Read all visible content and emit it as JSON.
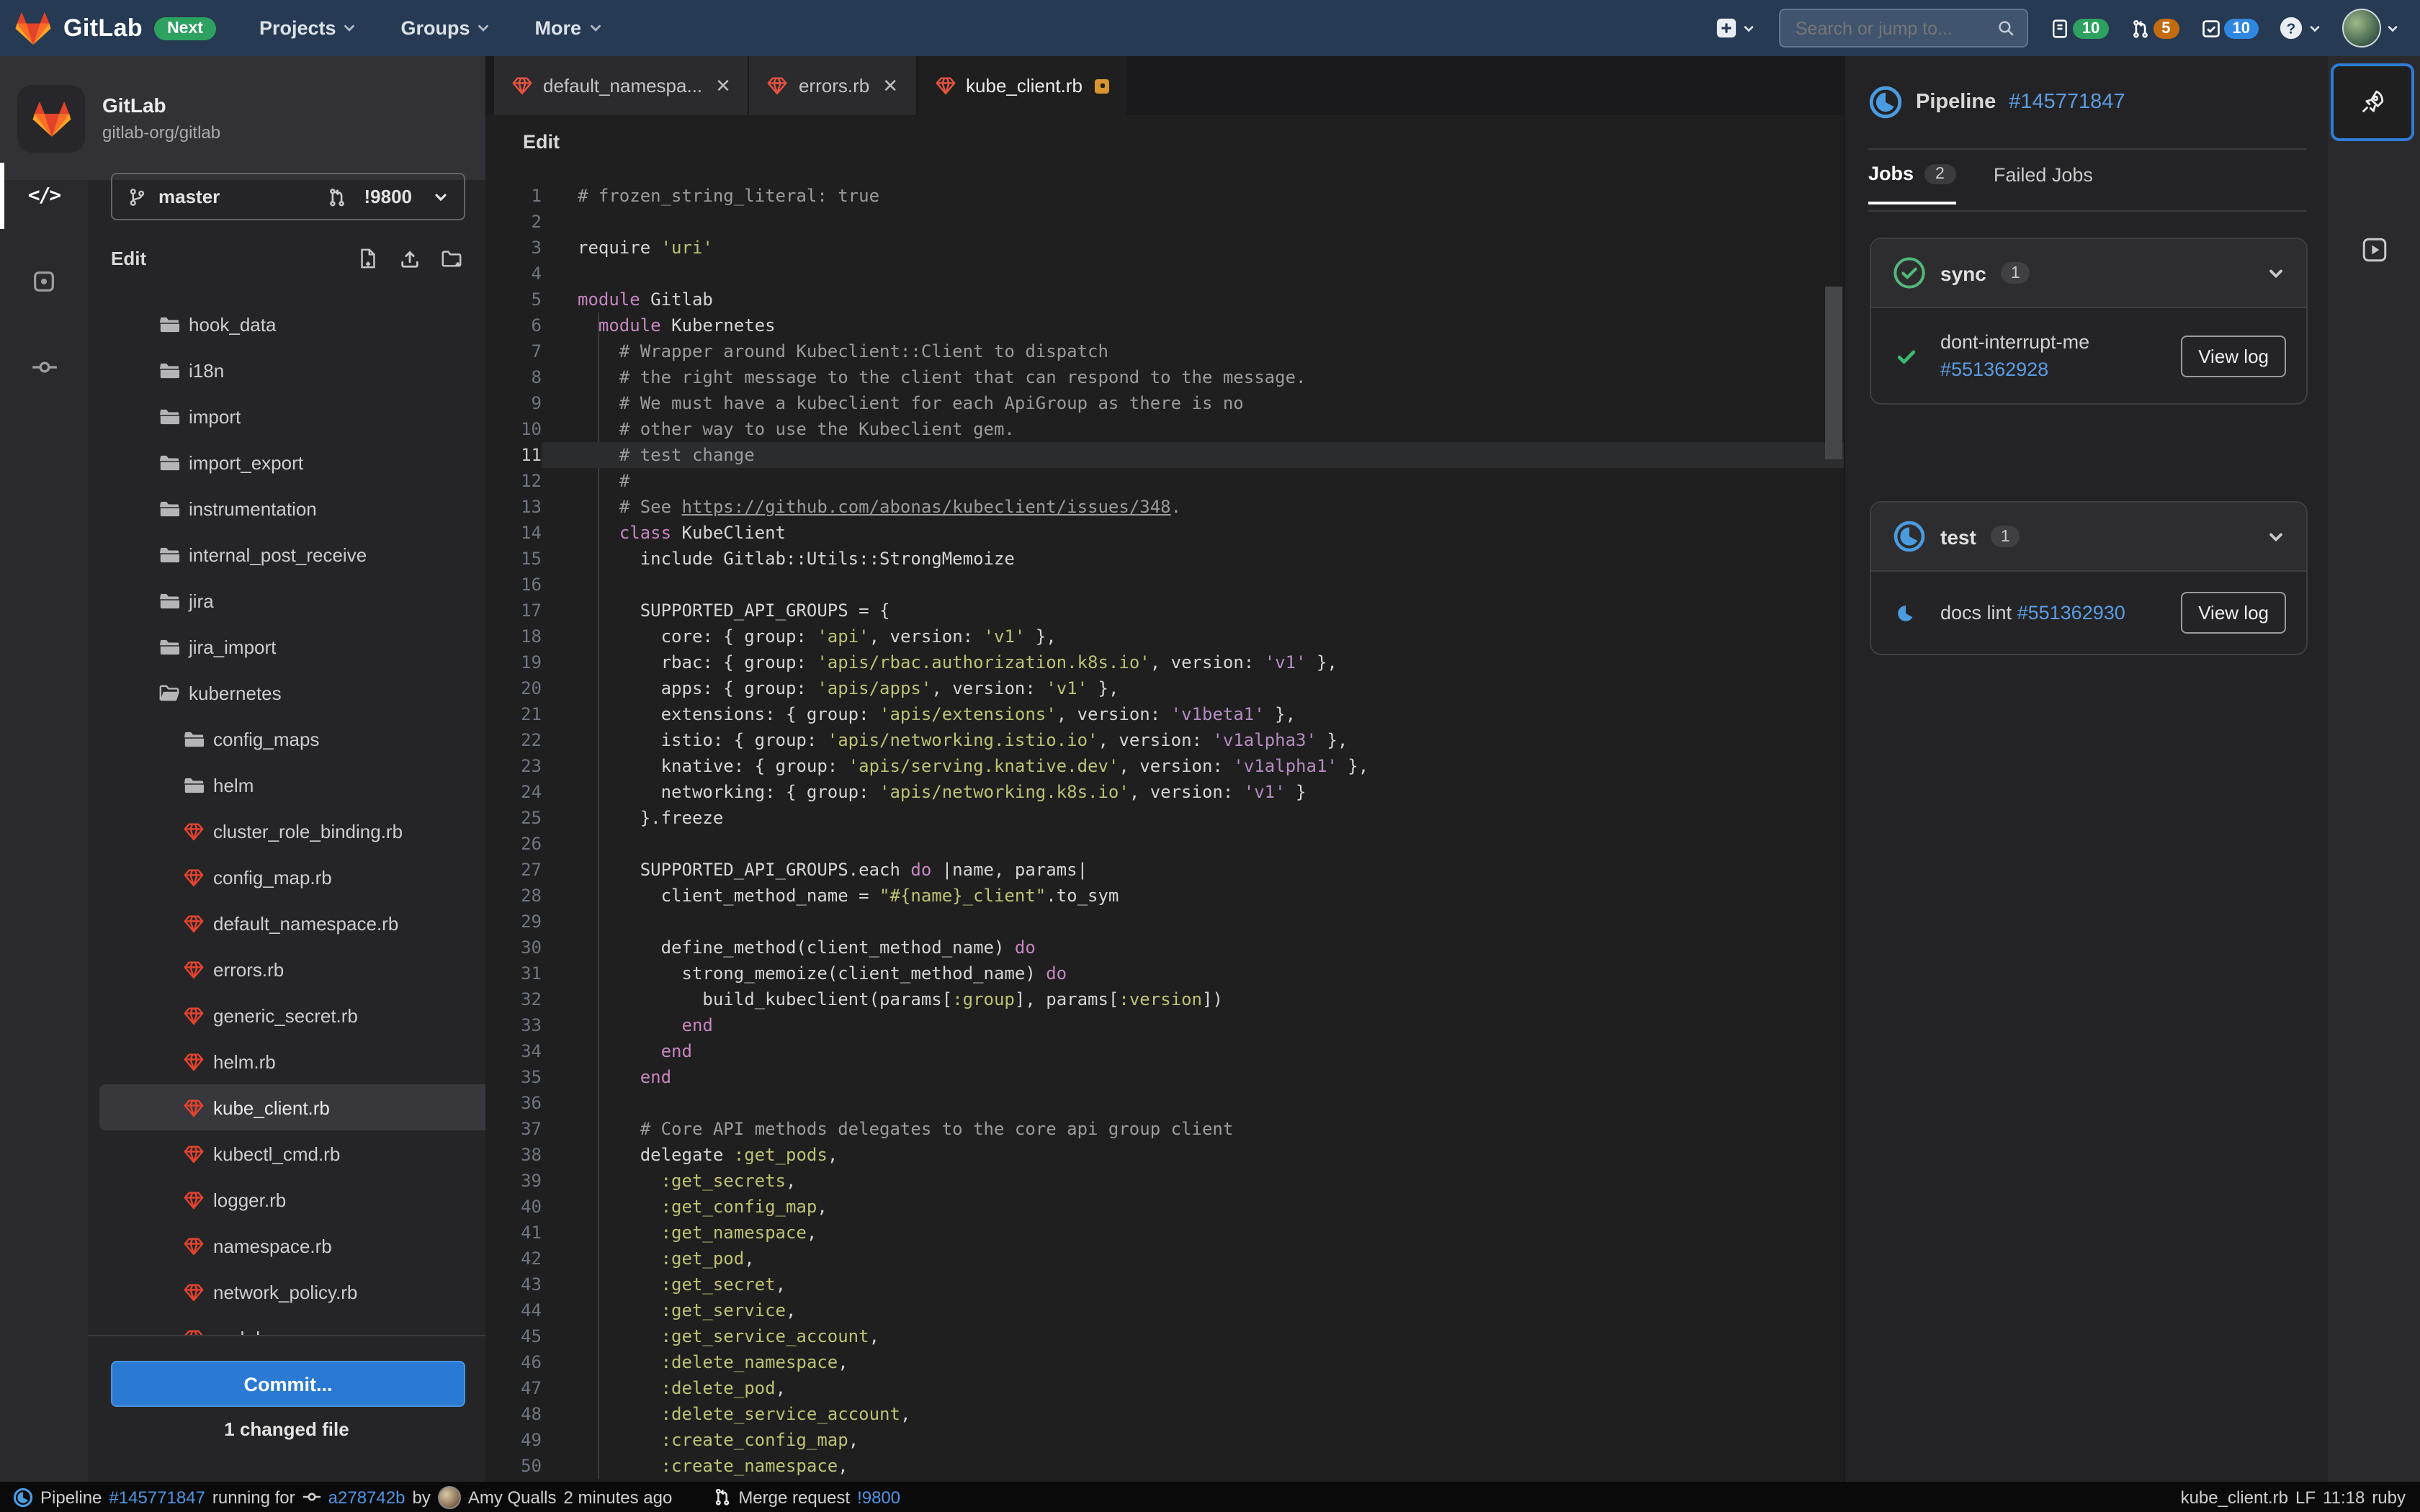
{
  "navbar": {
    "logo_label": "GitLab",
    "next_badge": "Next",
    "menus": [
      {
        "label": "Projects"
      },
      {
        "label": "Groups"
      },
      {
        "label": "More"
      }
    ],
    "search_placeholder": "Search or jump to...",
    "counters": {
      "issues": "10",
      "merge_requests": "5",
      "todos": "10"
    }
  },
  "sidebar": {
    "project": {
      "name": "GitLab",
      "path": "gitlab-org/gitlab"
    },
    "branch": {
      "name": "master",
      "merge_request": "!9800"
    },
    "section_label": "Edit",
    "tree": [
      {
        "name": "hook_data",
        "kind": "folder",
        "level": 0
      },
      {
        "name": "i18n",
        "kind": "folder",
        "level": 0
      },
      {
        "name": "import",
        "kind": "folder",
        "level": 0
      },
      {
        "name": "import_export",
        "kind": "folder",
        "level": 0
      },
      {
        "name": "instrumentation",
        "kind": "folder",
        "level": 0
      },
      {
        "name": "internal_post_receive",
        "kind": "folder",
        "level": 0
      },
      {
        "name": "jira",
        "kind": "folder",
        "level": 0
      },
      {
        "name": "jira_import",
        "kind": "folder",
        "level": 0
      },
      {
        "name": "kubernetes",
        "kind": "folder-open",
        "level": 0
      },
      {
        "name": "config_maps",
        "kind": "folder",
        "level": 1
      },
      {
        "name": "helm",
        "kind": "folder",
        "level": 1
      },
      {
        "name": "cluster_role_binding.rb",
        "kind": "ruby",
        "level": 1
      },
      {
        "name": "config_map.rb",
        "kind": "ruby",
        "level": 1
      },
      {
        "name": "default_namespace.rb",
        "kind": "ruby",
        "level": 1
      },
      {
        "name": "errors.rb",
        "kind": "ruby",
        "level": 1
      },
      {
        "name": "generic_secret.rb",
        "kind": "ruby",
        "level": 1
      },
      {
        "name": "helm.rb",
        "kind": "ruby",
        "level": 1
      },
      {
        "name": "kube_client.rb",
        "kind": "ruby",
        "level": 1,
        "selected": true,
        "modified": true
      },
      {
        "name": "kubectl_cmd.rb",
        "kind": "ruby",
        "level": 1
      },
      {
        "name": "logger.rb",
        "kind": "ruby",
        "level": 1
      },
      {
        "name": "namespace.rb",
        "kind": "ruby",
        "level": 1
      },
      {
        "name": "network_policy.rb",
        "kind": "ruby",
        "level": 1
      },
      {
        "name": "pod.rb",
        "kind": "ruby",
        "level": 1
      }
    ],
    "commit_button": "Commit...",
    "changed_files": "1 changed file"
  },
  "editor": {
    "tabs": [
      {
        "label": "default_namespa...",
        "closable": true
      },
      {
        "label": "errors.rb",
        "closable": true
      },
      {
        "label": "kube_client.rb",
        "modified": true,
        "active": true
      }
    ],
    "breadcrumb": "Edit",
    "current_line": 11,
    "code_lines": [
      {
        "n": 1,
        "seg": [
          [
            "c",
            "# frozen_string_literal: true"
          ]
        ]
      },
      {
        "n": 2,
        "seg": []
      },
      {
        "n": 3,
        "seg": [
          [
            "t",
            "require "
          ],
          [
            "s",
            "'uri'"
          ]
        ]
      },
      {
        "n": 4,
        "seg": []
      },
      {
        "n": 5,
        "seg": [
          [
            "k",
            "module"
          ],
          [
            "t",
            " Gitlab"
          ]
        ]
      },
      {
        "n": 6,
        "seg": [
          [
            "t",
            "  "
          ],
          [
            "k",
            "module"
          ],
          [
            "t",
            " Kubernetes"
          ]
        ]
      },
      {
        "n": 7,
        "seg": [
          [
            "c",
            "    # Wrapper around Kubeclient::Client to dispatch"
          ]
        ]
      },
      {
        "n": 8,
        "seg": [
          [
            "c",
            "    # the right message to the client that can respond to the message."
          ]
        ]
      },
      {
        "n": 9,
        "seg": [
          [
            "c",
            "    # We must have a kubeclient for each ApiGroup as there is no"
          ]
        ]
      },
      {
        "n": 10,
        "seg": [
          [
            "c",
            "    # other way to use the Kubeclient gem."
          ]
        ]
      },
      {
        "n": 11,
        "seg": [
          [
            "c",
            "    # test change"
          ]
        ]
      },
      {
        "n": 12,
        "seg": [
          [
            "c",
            "    #"
          ]
        ]
      },
      {
        "n": 13,
        "seg": [
          [
            "c",
            "    # See "
          ],
          [
            "u",
            "https://github.com/abonas/kubeclient/issues/348"
          ],
          [
            "c",
            "."
          ]
        ]
      },
      {
        "n": 14,
        "seg": [
          [
            "t",
            "    "
          ],
          [
            "k",
            "class"
          ],
          [
            "t",
            " KubeClient"
          ]
        ]
      },
      {
        "n": 15,
        "seg": [
          [
            "t",
            "      include Gitlab::Utils::StrongMemoize"
          ]
        ]
      },
      {
        "n": 16,
        "seg": []
      },
      {
        "n": 17,
        "seg": [
          [
            "t",
            "      SUPPORTED_API_GROUPS = {"
          ]
        ]
      },
      {
        "n": 18,
        "seg": [
          [
            "t",
            "        core: { group: "
          ],
          [
            "s",
            "'api'"
          ],
          [
            "t",
            ", version: "
          ],
          [
            "s",
            "'v1'"
          ],
          [
            "t",
            " },"
          ]
        ]
      },
      {
        "n": 19,
        "seg": [
          [
            "t",
            "        rbac: { group: "
          ],
          [
            "s",
            "'apis/rbac.authorization.k8s.io'"
          ],
          [
            "t",
            ", version: "
          ],
          [
            "p",
            "'v1'"
          ],
          [
            "t",
            " },"
          ]
        ]
      },
      {
        "n": 20,
        "seg": [
          [
            "t",
            "        apps: { group: "
          ],
          [
            "s",
            "'apis/apps'"
          ],
          [
            "t",
            ", version: "
          ],
          [
            "s",
            "'v1'"
          ],
          [
            "t",
            " },"
          ]
        ]
      },
      {
        "n": 21,
        "seg": [
          [
            "t",
            "        extensions: { group: "
          ],
          [
            "s",
            "'apis/extensions'"
          ],
          [
            "t",
            ", version: "
          ],
          [
            "p",
            "'v1beta1'"
          ],
          [
            "t",
            " },"
          ]
        ]
      },
      {
        "n": 22,
        "seg": [
          [
            "t",
            "        istio: { group: "
          ],
          [
            "s",
            "'apis/networking.istio.io'"
          ],
          [
            "t",
            ", version: "
          ],
          [
            "p",
            "'v1alpha3'"
          ],
          [
            "t",
            " },"
          ]
        ]
      },
      {
        "n": 23,
        "seg": [
          [
            "t",
            "        knative: { group: "
          ],
          [
            "s",
            "'apis/serving.knative.dev'"
          ],
          [
            "t",
            ", version: "
          ],
          [
            "p",
            "'v1alpha1'"
          ],
          [
            "t",
            " },"
          ]
        ]
      },
      {
        "n": 24,
        "seg": [
          [
            "t",
            "        networking: { group: "
          ],
          [
            "s",
            "'apis/networking.k8s.io'"
          ],
          [
            "t",
            ", version: "
          ],
          [
            "p",
            "'v1'"
          ],
          [
            "t",
            " }"
          ]
        ]
      },
      {
        "n": 25,
        "seg": [
          [
            "t",
            "      }.freeze"
          ]
        ]
      },
      {
        "n": 26,
        "seg": []
      },
      {
        "n": 27,
        "seg": [
          [
            "t",
            "      SUPPORTED_API_GROUPS.each "
          ],
          [
            "k",
            "do"
          ],
          [
            "t",
            " |name, params|"
          ]
        ]
      },
      {
        "n": 28,
        "seg": [
          [
            "t",
            "        client_method_name = "
          ],
          [
            "s",
            "\"#{name}_client\""
          ],
          [
            "t",
            ".to_sym"
          ]
        ]
      },
      {
        "n": 29,
        "seg": []
      },
      {
        "n": 30,
        "seg": [
          [
            "t",
            "        define_method(client_method_name) "
          ],
          [
            "k",
            "do"
          ]
        ]
      },
      {
        "n": 31,
        "seg": [
          [
            "t",
            "          strong_memoize(client_method_name) "
          ],
          [
            "k",
            "do"
          ]
        ]
      },
      {
        "n": 32,
        "seg": [
          [
            "t",
            "            build_kubeclient(params["
          ],
          [
            "s",
            ":group"
          ],
          [
            "t",
            "], params["
          ],
          [
            "s",
            ":version"
          ],
          [
            "t",
            "])"
          ]
        ]
      },
      {
        "n": 33,
        "seg": [
          [
            "t",
            "          "
          ],
          [
            "k",
            "end"
          ]
        ]
      },
      {
        "n": 34,
        "seg": [
          [
            "t",
            "        "
          ],
          [
            "k",
            "end"
          ]
        ]
      },
      {
        "n": 35,
        "seg": [
          [
            "t",
            "      "
          ],
          [
            "k",
            "end"
          ]
        ]
      },
      {
        "n": 36,
        "seg": []
      },
      {
        "n": 37,
        "seg": [
          [
            "c",
            "      # Core API methods delegates to the core api group client"
          ]
        ]
      },
      {
        "n": 38,
        "seg": [
          [
            "t",
            "      delegate "
          ],
          [
            "s",
            ":get_pods"
          ],
          [
            "t",
            ","
          ]
        ]
      },
      {
        "n": 39,
        "seg": [
          [
            "t",
            "        "
          ],
          [
            "s",
            ":get_secrets"
          ],
          [
            "t",
            ","
          ]
        ]
      },
      {
        "n": 40,
        "seg": [
          [
            "t",
            "        "
          ],
          [
            "s",
            ":get_config_map"
          ],
          [
            "t",
            ","
          ]
        ]
      },
      {
        "n": 41,
        "seg": [
          [
            "t",
            "        "
          ],
          [
            "s",
            ":get_namespace"
          ],
          [
            "t",
            ","
          ]
        ]
      },
      {
        "n": 42,
        "seg": [
          [
            "t",
            "        "
          ],
          [
            "s",
            ":get_pod"
          ],
          [
            "t",
            ","
          ]
        ]
      },
      {
        "n": 43,
        "seg": [
          [
            "t",
            "        "
          ],
          [
            "s",
            ":get_secret"
          ],
          [
            "t",
            ","
          ]
        ]
      },
      {
        "n": 44,
        "seg": [
          [
            "t",
            "        "
          ],
          [
            "s",
            ":get_service"
          ],
          [
            "t",
            ","
          ]
        ]
      },
      {
        "n": 45,
        "seg": [
          [
            "t",
            "        "
          ],
          [
            "s",
            ":get_service_account"
          ],
          [
            "t",
            ","
          ]
        ]
      },
      {
        "n": 46,
        "seg": [
          [
            "t",
            "        "
          ],
          [
            "s",
            ":delete_namespace"
          ],
          [
            "t",
            ","
          ]
        ]
      },
      {
        "n": 47,
        "seg": [
          [
            "t",
            "        "
          ],
          [
            "s",
            ":delete_pod"
          ],
          [
            "t",
            ","
          ]
        ]
      },
      {
        "n": 48,
        "seg": [
          [
            "t",
            "        "
          ],
          [
            "s",
            ":delete_service_account"
          ],
          [
            "t",
            ","
          ]
        ]
      },
      {
        "n": 49,
        "seg": [
          [
            "t",
            "        "
          ],
          [
            "s",
            ":create_config_map"
          ],
          [
            "t",
            ","
          ]
        ]
      },
      {
        "n": 50,
        "seg": [
          [
            "t",
            "        "
          ],
          [
            "s",
            ":create_namespace"
          ],
          [
            "t",
            ","
          ]
        ]
      }
    ]
  },
  "pipeline_panel": {
    "title": "Pipeline",
    "id": "#145771847",
    "tabs": [
      {
        "label": "Jobs",
        "count": "2",
        "active": true
      },
      {
        "label": "Failed Jobs"
      }
    ],
    "stages": [
      {
        "name": "sync",
        "count": "1",
        "status": "success",
        "layout": "stacked",
        "jobs": [
          {
            "name": "dont-interrupt-me",
            "id": "#551362928",
            "status": "success",
            "action": "View log"
          }
        ]
      },
      {
        "name": "test",
        "count": "1",
        "status": "running",
        "layout": "inline",
        "jobs": [
          {
            "name": "docs lint",
            "id": "#551362930",
            "status": "running",
            "action": "View log"
          }
        ]
      }
    ]
  },
  "status_bar": {
    "left": {
      "pipeline_label": "Pipeline",
      "pipeline_id": "#145771847",
      "running_for": "running for",
      "commit": "a278742b",
      "by": "by",
      "author": "Amy Qualls",
      "time": "2 minutes ago",
      "mr_label": "Merge request",
      "mr_id": "!9800"
    },
    "right": {
      "file": "kube_client.rb",
      "eol": "LF",
      "position": "11:18",
      "language": "ruby"
    }
  },
  "icons": {
    "close": "✕",
    "names": [
      "tanuki-logo",
      "chevron-down",
      "plus-box",
      "search",
      "issues",
      "merge-request",
      "todo",
      "help",
      "avatar",
      "git-branch",
      "new-file",
      "upload",
      "new-folder",
      "code",
      "review",
      "commit",
      "folder",
      "folder-open",
      "ruby-gem",
      "modified-badge",
      "pipeline-running",
      "status-success",
      "status-running",
      "rocket",
      "live-preview"
    ]
  },
  "colors": {
    "navbar_bg": "#273a53",
    "accent_blue": "#2e7cd5",
    "link_blue": "#5b9ce2",
    "success_green": "#2da160",
    "warning_orange": "#c26b10",
    "modified_orange": "#d99530",
    "gem_red": "#e5432e",
    "editor_bg": "#1f1f1f",
    "string_olive": "#bdc174",
    "keyword_purple": "#c586c0"
  }
}
